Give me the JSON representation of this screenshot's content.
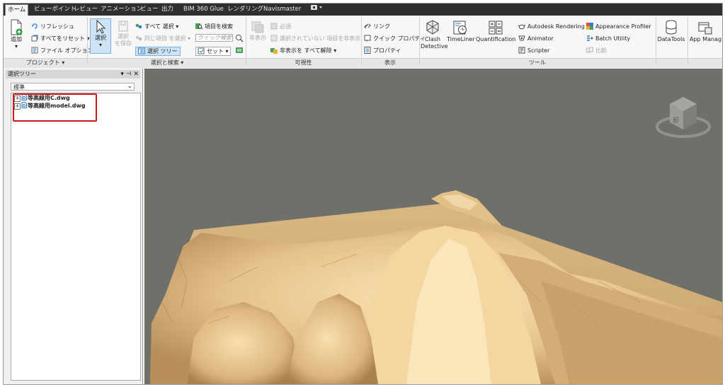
{
  "tabs": [
    {
      "label": "ホーム",
      "active": true
    },
    {
      "label": "ビューポイント"
    },
    {
      "label": "レビュー"
    },
    {
      "label": "アニメーション"
    },
    {
      "label": "ビュー"
    },
    {
      "label": "出力"
    },
    {
      "label": "BIM 360 Glue"
    },
    {
      "label": "レンダリング"
    },
    {
      "label": "Navismaster"
    }
  ],
  "ribbon": {
    "project": {
      "add_label": "追加",
      "refresh": "リフレッシュ",
      "reset_all": "すべてをリセット",
      "file_options": "ファイル オプション",
      "title": "プロジェクト"
    },
    "select": {
      "select_label": "選択",
      "save_selection_1": "選択",
      "save_selection_2": "を保存",
      "select_all": "すべて 選択",
      "select_same": "同じ項目 を選択",
      "selection_tree": "選択 ツリー",
      "find_items": "項目を検索",
      "quick_find_placeholder": "クイック検索",
      "sets": "セット",
      "title": "選択と検索"
    },
    "visibility": {
      "hide": "非表示",
      "require": "必須",
      "hide_unselected": "選択されていない 項目を非表示",
      "unhide_all": "非表示を すべて解除",
      "title": "可視性"
    },
    "display": {
      "links": "リンク",
      "quick_properties": "クイック プロパティ",
      "properties": "プロパティ",
      "title": "表示"
    },
    "tools": {
      "clash_1": "Clash",
      "clash_2": "Detective",
      "timeliner": "TimeLiner",
      "quantification": "Quantification",
      "autodesk_rendering": "Autodesk Rendering",
      "animator": "Animator",
      "scripter": "Scripter",
      "appearance_profiler": "Appearance Profiler",
      "batch_utility": "Batch Utility",
      "compare": "比較",
      "datatools": "DataTools",
      "app_manager": "App Manag",
      "title": "ツール"
    }
  },
  "selection_tree": {
    "title": "選択ツリー",
    "mode": "標準",
    "items": [
      "等高線用C.dwg",
      "等高線用model.dwg"
    ]
  },
  "viewcube": {
    "label": "前"
  },
  "colors": {
    "terrain": "#e7c48f",
    "viewport_bg": "#6f706a",
    "highlight": "#cc1a1a"
  }
}
